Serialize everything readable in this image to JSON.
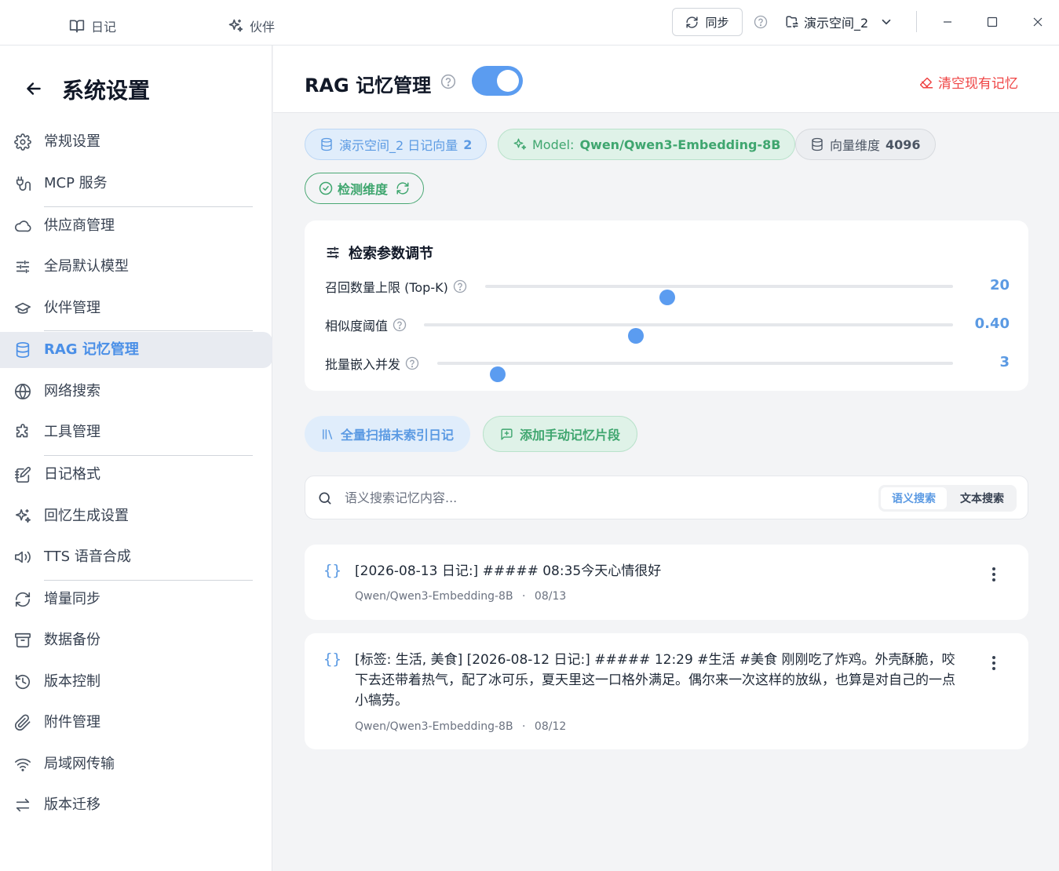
{
  "titlebar": {
    "tabs": [
      {
        "label": "日记",
        "icon": "book-open-icon"
      },
      {
        "label": "伙伴",
        "icon": "sparkles-icon"
      }
    ],
    "sync_label": "同步",
    "workspace": "演示空间_2"
  },
  "sidebar": {
    "title": "系统设置",
    "items": [
      {
        "label": "常规设置",
        "icon": "gear-icon"
      },
      {
        "label": "MCP 服务",
        "icon": "mcp-plug-icon"
      },
      {
        "label": "供应商管理",
        "icon": "cloud-icon"
      },
      {
        "label": "全局默认模型",
        "icon": "sliders-icon"
      },
      {
        "label": "伙伴管理",
        "icon": "graduation-cap-icon"
      },
      {
        "label": "RAG 记忆管理",
        "icon": "database-icon",
        "active": true
      },
      {
        "label": "网络搜索",
        "icon": "globe-icon"
      },
      {
        "label": "工具管理",
        "icon": "puzzle-icon"
      },
      {
        "label": "日记格式",
        "icon": "notebook-pen-icon"
      },
      {
        "label": "回忆生成设置",
        "icon": "sparkles-icon"
      },
      {
        "label": "TTS 语音合成",
        "icon": "speaker-icon"
      },
      {
        "label": "增量同步",
        "icon": "refresh-icon"
      },
      {
        "label": "数据备份",
        "icon": "archive-icon"
      },
      {
        "label": "版本控制",
        "icon": "history-icon"
      },
      {
        "label": "附件管理",
        "icon": "paperclip-icon"
      },
      {
        "label": "局域网传输",
        "icon": "wifi-icon"
      },
      {
        "label": "版本迁移",
        "icon": "swap-arrows-icon"
      }
    ]
  },
  "main": {
    "title": "RAG 记忆管理",
    "enabled": true,
    "clear_label": "清空现有记忆",
    "chips": {
      "space_label": "演示空间_2 日记向量",
      "space_count": "2",
      "model_label": "Model:",
      "model_value": "Qwen/Qwen3-Embedding-8B",
      "dim_label": "向量维度",
      "dim_value": "4096",
      "check_label": "检测维度"
    },
    "params": {
      "title": "检索参数调节",
      "rows": [
        {
          "label": "召回数量上限 (Top-K)",
          "value": "20",
          "fraction": 0.39
        },
        {
          "label": "相似度阈值",
          "value": "0.40",
          "fraction": 0.4
        },
        {
          "label": "批量嵌入并发",
          "value": "3",
          "fraction": 0.117
        }
      ]
    },
    "actions": {
      "scan_label": "全量扫描未索引日记",
      "add_label": "添加手动记忆片段"
    },
    "search": {
      "placeholder": "语义搜索记忆内容...",
      "value": "",
      "mode_semantic": "语义搜索",
      "mode_text": "文本搜索",
      "active_mode": "语义搜索"
    },
    "memories": [
      {
        "icon": "{}",
        "text": "[2026-08-13 日记:] ##### 08:35今天心情很好",
        "model": "Qwen/Qwen3-Embedding-8B",
        "dot": "·",
        "date": "08/13"
      },
      {
        "icon": "{}",
        "text": "[标签: 生活, 美食] [2026-08-12 日记:] ##### 12:29 #生活 #美食 刚刚吃了炸鸡。外壳酥脆，咬下去还带着热气，配了冰可乐，夏天里这一口格外满足。偶尔来一次这样的放纵，也算是对自己的一点小犒劳。",
        "model": "Qwen/Qwen3-Embedding-8B",
        "dot": "·",
        "date": "08/12"
      }
    ]
  },
  "colors": {
    "accent_blue": "#5b9cf0",
    "accent_green": "#3fa66f",
    "danger_red": "#ef4444"
  }
}
